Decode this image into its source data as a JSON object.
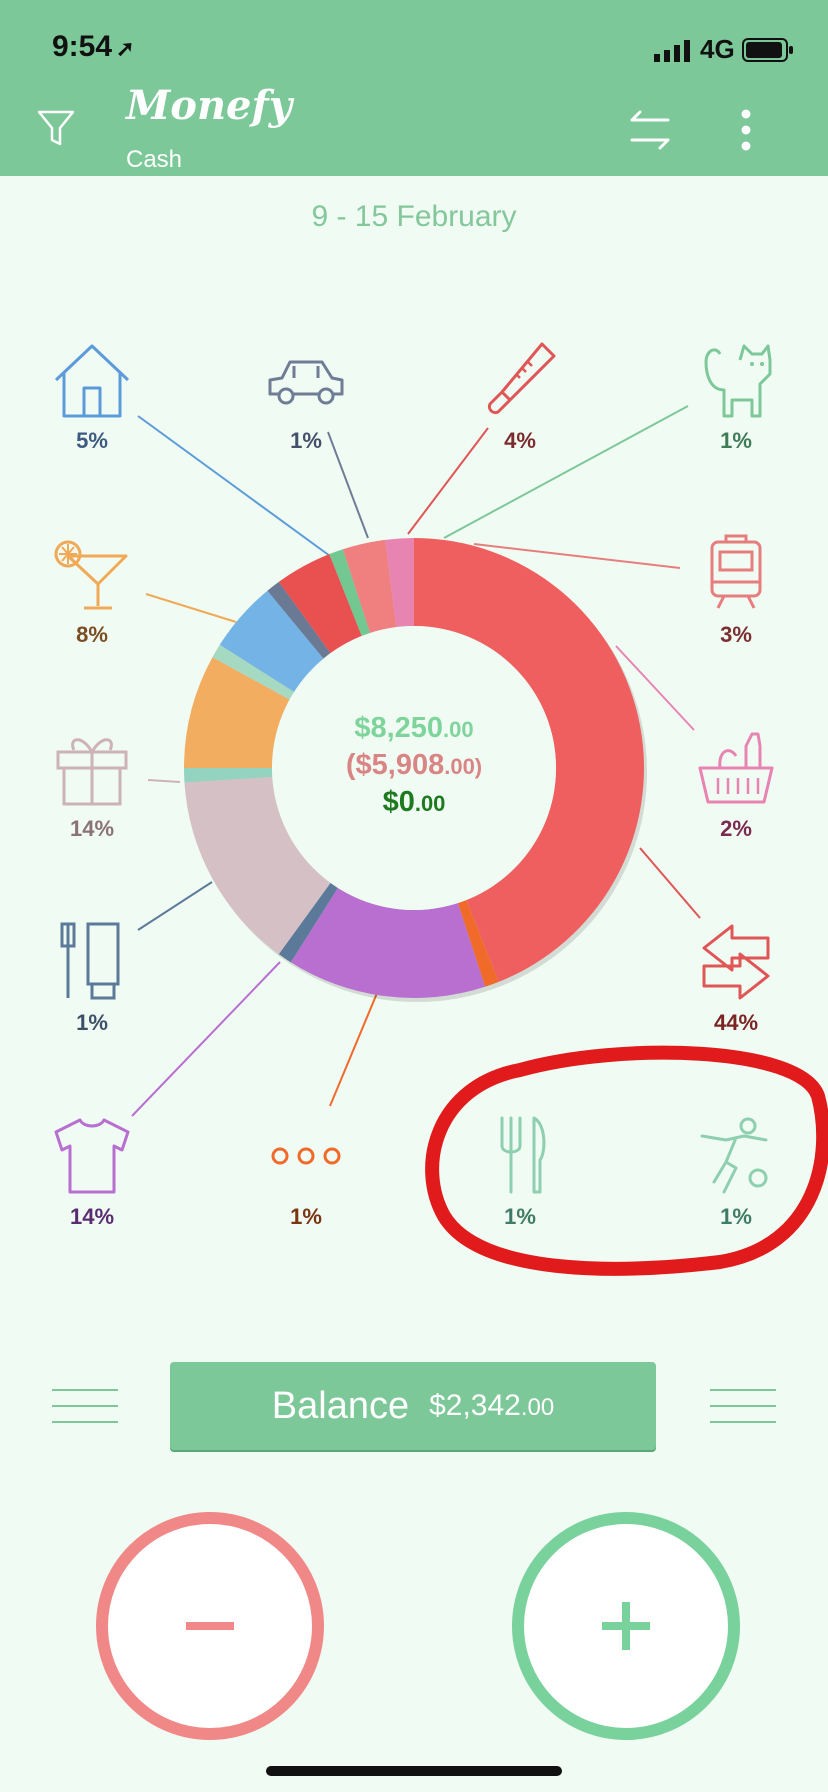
{
  "status_bar": {
    "time": "9:54",
    "network": "4G"
  },
  "app_bar": {
    "brand": "Monefy",
    "account": "Cash"
  },
  "date_range": "9 - 15 February",
  "categories": [
    {
      "name": "house",
      "percent": "5%",
      "icon": "house-icon",
      "color": "#5b9bd9",
      "label_color": "#3d5a80"
    },
    {
      "name": "car",
      "percent": "1%",
      "icon": "car-icon",
      "color": "#6f7c96",
      "label_color": "#44506a"
    },
    {
      "name": "health",
      "percent": "4%",
      "icon": "thermometer-icon",
      "color": "#e05555",
      "label_color": "#7a2b2b"
    },
    {
      "name": "pets",
      "percent": "1%",
      "icon": "cat-icon",
      "color": "#7cc898",
      "label_color": "#3f7b56"
    },
    {
      "name": "entertainment",
      "percent": "8%",
      "icon": "cocktail-icon",
      "color": "#f0a955",
      "label_color": "#7a4e22"
    },
    {
      "name": "transport",
      "percent": "3%",
      "icon": "train-icon",
      "color": "#e67e7e",
      "label_color": "#7a3030"
    },
    {
      "name": "gifts",
      "percent": "14%",
      "icon": "gift-icon",
      "color": "#cdb3b9",
      "label_color": "#8a7277"
    },
    {
      "name": "groceries",
      "percent": "2%",
      "icon": "basket-icon",
      "color": "#e884b2",
      "label_color": "#7a2a4e"
    },
    {
      "name": "toiletry",
      "percent": "1%",
      "icon": "toiletry-icon",
      "color": "#5b7a99",
      "label_color": "#3d5068"
    },
    {
      "name": "transfers",
      "percent": "44%",
      "icon": "transfer-arrows-icon",
      "color": "#f05f5f",
      "label_color": "#7a2424"
    },
    {
      "name": "clothes",
      "percent": "14%",
      "icon": "tshirt-icon",
      "color": "#b86fd0",
      "label_color": "#5a2d70"
    },
    {
      "name": "other",
      "percent": "1%",
      "icon": "dots-icon",
      "color": "#f06a2a",
      "label_color": "#7a3512"
    },
    {
      "name": "food",
      "percent": "1%",
      "icon": "fork-knife-icon",
      "color": "#8ecfb0",
      "label_color": "#3f7b66"
    },
    {
      "name": "sports",
      "percent": "1%",
      "icon": "soccer-icon",
      "color": "#8ecfb0",
      "label_color": "#3f7b66"
    }
  ],
  "chart_data": {
    "type": "pie",
    "labels": [
      "transfers",
      "other",
      "clothes",
      "toiletry",
      "gifts",
      "food",
      "entertainment",
      "sports",
      "house",
      "car",
      "health",
      "pets",
      "transport",
      "groceries"
    ],
    "values": [
      44,
      1,
      14,
      1,
      14,
      1,
      8,
      1,
      5,
      1,
      4,
      1,
      3,
      2
    ],
    "colors": [
      "#f05f5f",
      "#f06a2a",
      "#b86fd0",
      "#5b7a99",
      "#d4c0c5",
      "#93d3bf",
      "#f2ad60",
      "#a6d9c2",
      "#74b3e6",
      "#6a7a94",
      "#e95050",
      "#72c890",
      "#f07f7f",
      "#e884b2"
    ]
  },
  "summary": {
    "income_main": "$8,250",
    "income_cents": ".00",
    "expense_main": "($5,908",
    "expense_cents": ".00)",
    "balance_main": "$0",
    "balance_cents": ".00"
  },
  "balance_bar": {
    "label": "Balance",
    "amount_main": "$2,342",
    "amount_cents": ".00"
  },
  "colors": {
    "theme": "#7cc898",
    "expense_button": "#f08888",
    "income_button": "#79d19b",
    "annotation": "#e11b1b"
  }
}
